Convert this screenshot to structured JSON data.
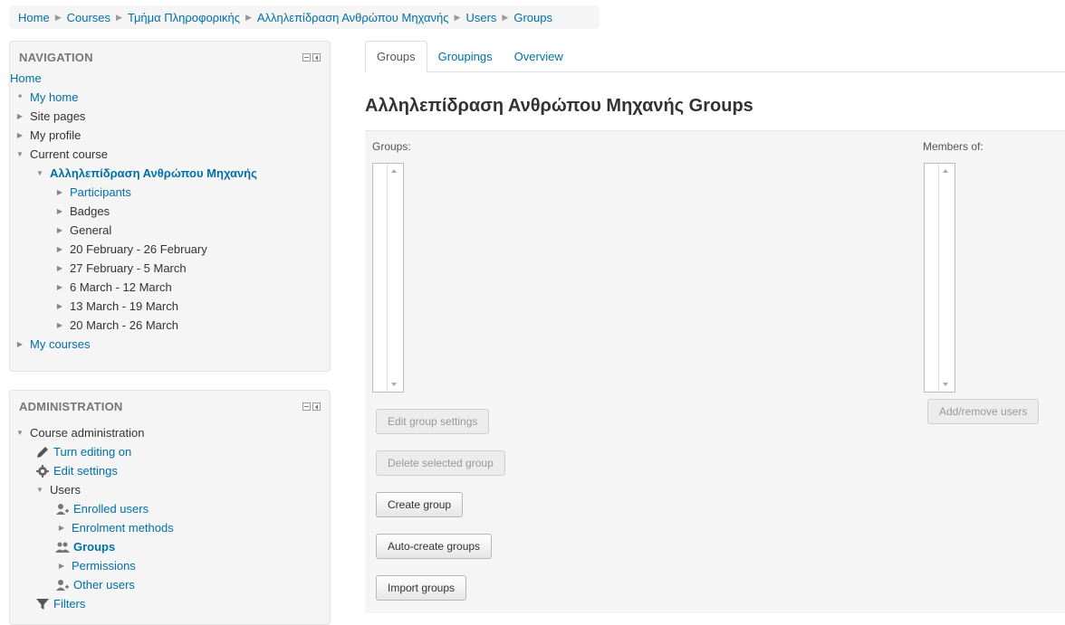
{
  "breadcrumb": [
    "Home",
    "Courses",
    "Τμήμα Πληροφορικής",
    "Αλληλεπίδραση Ανθρώπου Μηχανής",
    "Users",
    "Groups"
  ],
  "navigation": {
    "title": "NAVIGATION",
    "home": "Home",
    "my_home": "My home",
    "site_pages": "Site pages",
    "my_profile": "My profile",
    "current_course": "Current course",
    "course_name": "Αλληλεπίδραση Ανθρώπου Μηχανής",
    "course_items": [
      "Participants",
      "Badges",
      "General",
      "20 February - 26 February",
      "27 February - 5 March",
      "6 March - 12 March",
      "13 March - 19 March",
      "20 March - 26 March"
    ],
    "my_courses": "My courses"
  },
  "administration": {
    "title": "ADMINISTRATION",
    "course_admin": "Course administration",
    "turn_editing_on": "Turn editing on",
    "edit_settings": "Edit settings",
    "users": "Users",
    "enrolled_users": "Enrolled users",
    "enrolment_methods": "Enrolment methods",
    "groups": "Groups",
    "permissions": "Permissions",
    "other_users": "Other users",
    "filters": "Filters"
  },
  "tabs": [
    "Groups",
    "Groupings",
    "Overview"
  ],
  "page_title": "Αλληλεπίδραση Ανθρώπου Μηχανής Groups",
  "groups_label": "Groups:",
  "members_label": "Members of:",
  "buttons": {
    "edit_group_settings": "Edit group settings",
    "delete_selected_group": "Delete selected group",
    "create_group": "Create group",
    "auto_create_groups": "Auto-create groups",
    "import_groups": "Import groups",
    "add_remove_users": "Add/remove users"
  }
}
